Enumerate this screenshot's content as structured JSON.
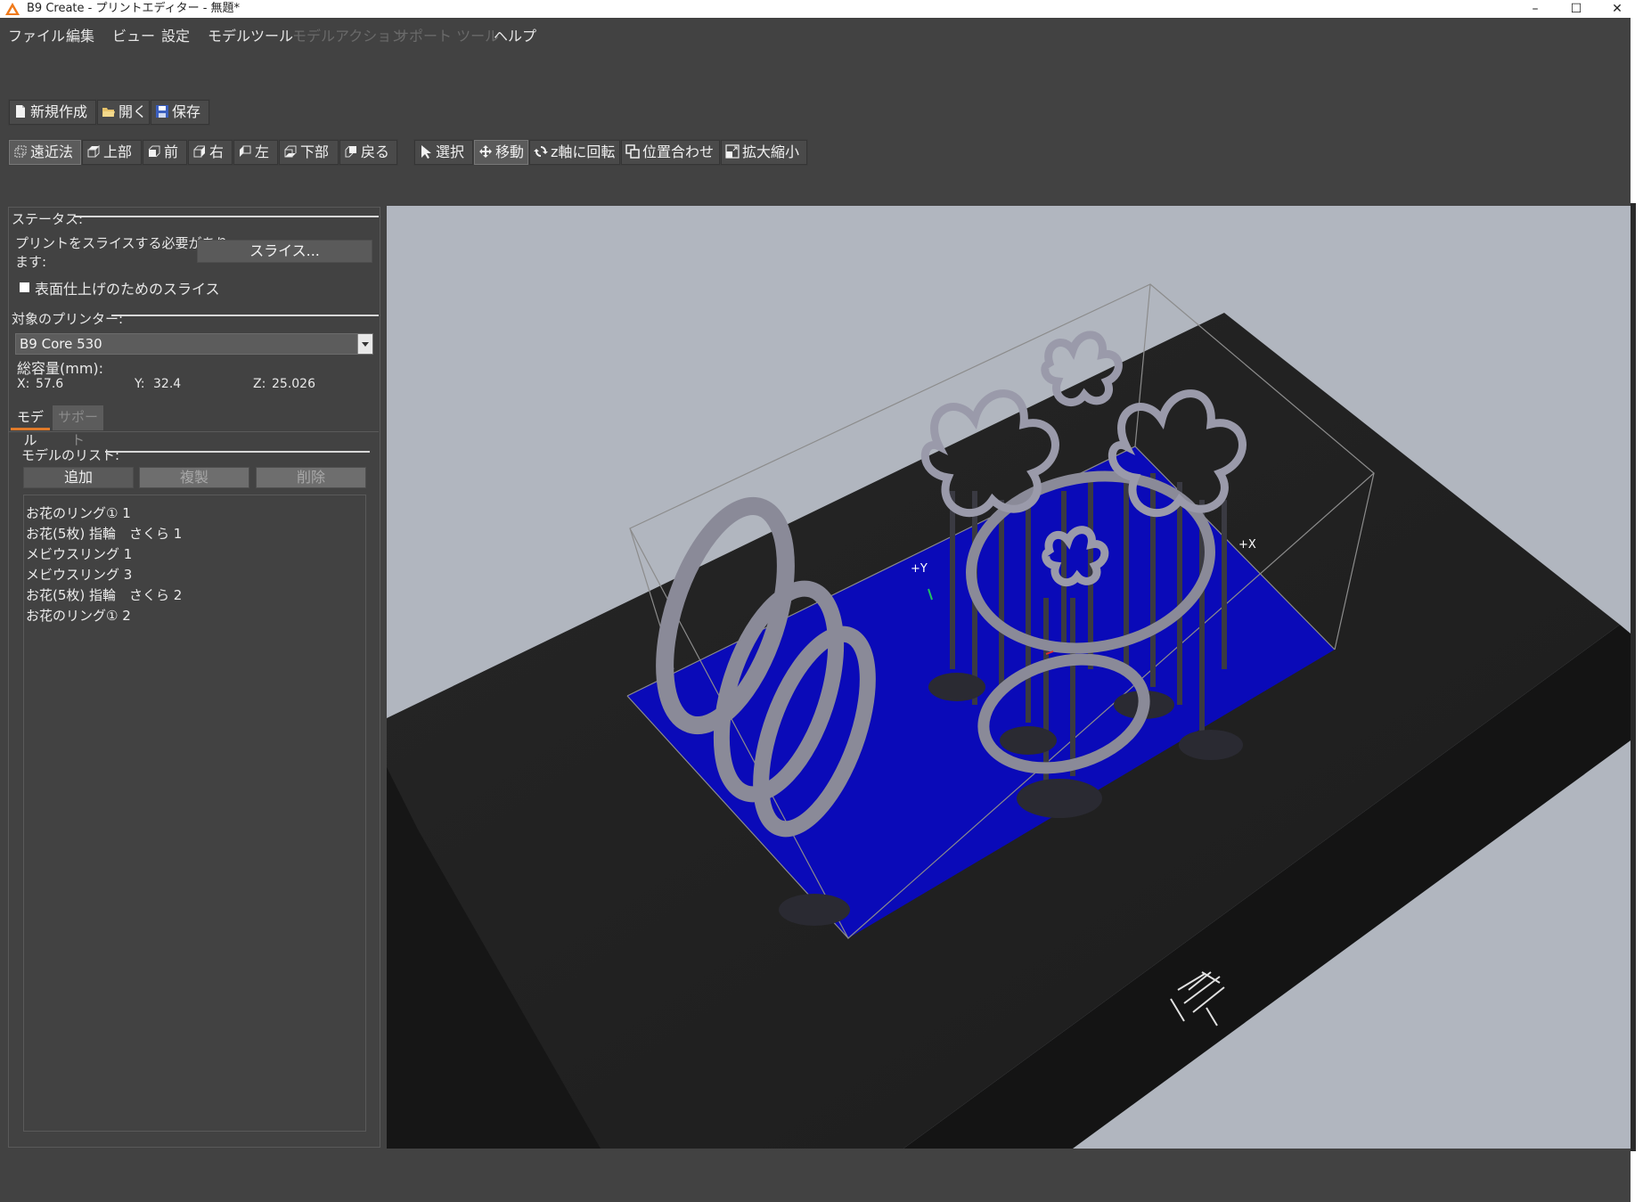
{
  "window": {
    "title": "B9 Create - プリントエディター - 無題*",
    "minimize_glyph": "–",
    "maximize_glyph": "☐",
    "close_glyph": "✕"
  },
  "menu": [
    {
      "label": "ファイル",
      "enabled": true
    },
    {
      "label": "編集",
      "enabled": true
    },
    {
      "label": "ビュー",
      "enabled": true
    },
    {
      "label": "設定",
      "enabled": true
    },
    {
      "label": "モデルツール",
      "enabled": true
    },
    {
      "label": "モデルアクション",
      "enabled": false
    },
    {
      "label": "サポート ツール",
      "enabled": false
    },
    {
      "label": "ヘルプ",
      "enabled": true
    }
  ],
  "file_toolbar": {
    "new_label": "新規作成",
    "open_label": "開く",
    "save_label": "保存"
  },
  "view_toolbar": {
    "perspective_label": "遠近法",
    "top_label": "上部",
    "front_label": "前",
    "right_label": "右",
    "left_label": "左",
    "bottom_label": "下部",
    "back_label": "戻る"
  },
  "tool_toolbar": {
    "select_label": "選択",
    "move_label": "移動",
    "rotate_label": "z軸に回転",
    "align_label": "位置合わせ",
    "scale_label": "拡大縮小"
  },
  "status": {
    "group_title": "ステータス:",
    "message_line1": "プリントをスライスする必要があり",
    "message_line2": "ます:",
    "slice_button": "スライス...",
    "surface_slice_label": "表面仕上げのためのスライス"
  },
  "printer": {
    "group_title": "対象のプリンター:",
    "selected": "B9 Core 530",
    "volume_label": "総容量(mm):",
    "x_label": "X:",
    "x_value": "57.6",
    "y_label": "Y:",
    "y_value": "32.4",
    "z_label": "Z:",
    "z_value": "25.026"
  },
  "tabs": {
    "model_tab": "モデル",
    "support_tab": "サポート"
  },
  "model_list": {
    "group_title": "モデルのリスト:",
    "add_button": "追加",
    "duplicate_button": "複製",
    "delete_button": "削除",
    "items": [
      "お花のリング① 1",
      "お花(5枚) 指輪　さくら 1",
      "メビウスリング 1",
      "メビウスリング 3",
      "お花(5枚) 指輪　さくら 2",
      "お花のリング① 2"
    ]
  },
  "viewport": {
    "axis_y_label": "+Y",
    "axis_x_label": "+X",
    "build_plate_color": "#0a0ab8",
    "base_color": "#1f1f1f",
    "background_color": "#b1b6bf",
    "model_color": "#8a8a98"
  }
}
